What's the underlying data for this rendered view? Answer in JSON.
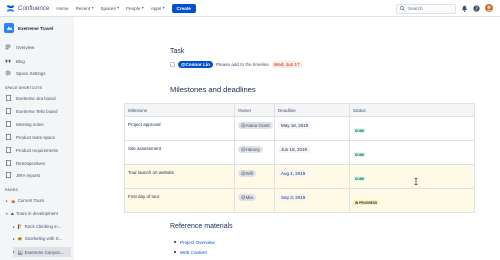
{
  "topbar": {
    "product": "Confluence",
    "nav": [
      {
        "label": "Home",
        "caret": false
      },
      {
        "label": "Recent",
        "caret": true
      },
      {
        "label": "Spaces",
        "caret": true
      },
      {
        "label": "People",
        "caret": true
      },
      {
        "label": "Apps",
        "caret": true
      }
    ],
    "create_label": "Create",
    "search_placeholder": "Search"
  },
  "sidebar": {
    "space_name": "Exetreme Travel",
    "items": [
      {
        "label": "Overview",
        "icon": "overview-icon"
      },
      {
        "label": "Blog",
        "icon": "quote-icon"
      },
      {
        "label": "Space Settings",
        "icon": "gear-icon"
      }
    ],
    "shortcuts_heading": "SPACE SHORTCUTS",
    "shortcuts": [
      "Exetreme Jira board",
      "Exetreme Tello board",
      "Meeting notes",
      "Product team space",
      "Product requirements",
      "Retrospectives",
      "JIRA reports"
    ],
    "pages_heading": "PAGES",
    "pages": [
      {
        "label": "Current Tours",
        "indent": 0
      },
      {
        "label": "Tours in development",
        "indent": 0
      },
      {
        "label": "Rock Climbing in...",
        "indent": 1
      },
      {
        "label": "Snorkeling with S...",
        "indent": 1
      },
      {
        "label": "Exetreme Canyon...",
        "indent": 1,
        "selected": true
      }
    ]
  },
  "task": {
    "title": "Task",
    "mention": "@Connor Lin",
    "text": "Please add to the timeline",
    "due": "Wed, Jun 17"
  },
  "milestones": {
    "title": "Milestones and deadlines",
    "headers": [
      "Milestone",
      "Owner",
      "Deadline",
      "Status"
    ],
    "rows": [
      {
        "milestone": "Project approval",
        "owner": "@Alana Grant",
        "deadline": "May 18, 2019",
        "status": "DONE",
        "highlight": false
      },
      {
        "milestone": "Site assessment",
        "owner": "@Harvey",
        "deadline": "Jun 15, 2019",
        "status": "DONE",
        "highlight": false
      },
      {
        "milestone": "Tour launch on website",
        "owner": "@Will",
        "deadline": "Aug 1, 2019",
        "status": "DONE",
        "highlight": true
      },
      {
        "milestone": "First day of tour",
        "owner": "@Mia",
        "deadline": "Sep 3, 2019",
        "status": "IN PROGRESS",
        "highlight": true
      }
    ]
  },
  "references": {
    "title": "Reference materials",
    "links": [
      "Project Overview",
      "Web Content"
    ]
  }
}
